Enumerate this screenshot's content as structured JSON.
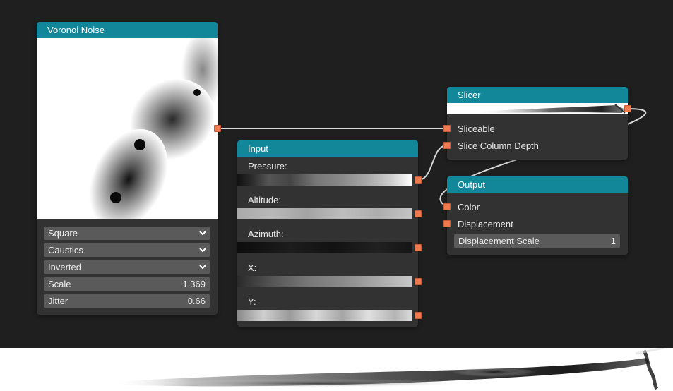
{
  "voronoi": {
    "title": "Voronoi Noise",
    "dropdowns": [
      {
        "value": "Square"
      },
      {
        "value": "Caustics"
      },
      {
        "value": "Inverted"
      }
    ],
    "scale": {
      "label": "Scale",
      "value": "1.369"
    },
    "jitter": {
      "label": "Jitter",
      "value": "0.66"
    }
  },
  "input": {
    "title": "Input",
    "fields": [
      {
        "label": "Pressure:"
      },
      {
        "label": "Altitude:"
      },
      {
        "label": "Azimuth:"
      },
      {
        "label": "X:"
      },
      {
        "label": "Y:"
      }
    ]
  },
  "slicer": {
    "title": "Slicer",
    "ports": [
      {
        "label": "Sliceable"
      },
      {
        "label": "Slice Column Depth"
      }
    ]
  },
  "output": {
    "title": "Output",
    "ports": [
      {
        "label": "Color"
      },
      {
        "label": "Displacement"
      }
    ],
    "displacement_scale": {
      "label": "Displacement Scale",
      "value": "1"
    }
  },
  "colors": {
    "header": "#13879a",
    "port": "#f07a50",
    "node_body": "#323232",
    "canvas": "#1f1f1f"
  }
}
